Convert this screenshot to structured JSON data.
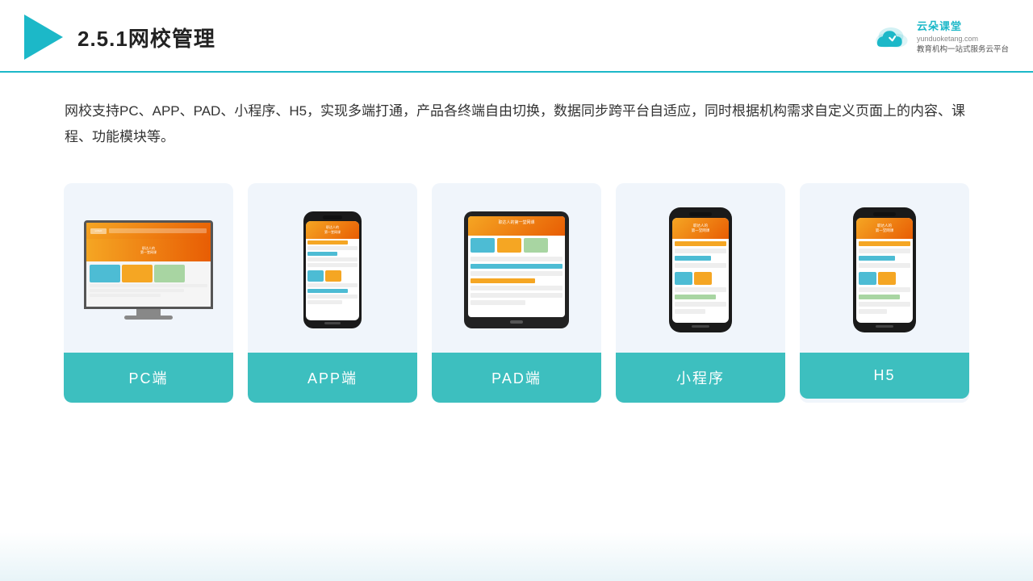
{
  "header": {
    "title": "2.5.1网校管理",
    "brand": {
      "name": "云朵课堂",
      "url": "yunduoketang.com",
      "slogan": "教育机构一站式服务云平台"
    }
  },
  "description": {
    "text": "网校支持PC、APP、PAD、小程序、H5，实现多端打通，产品各终端自由切换，数据同步跨平台自适应，同时根据机构需求自定义页面上的内容、课程、功能模块等。"
  },
  "cards": [
    {
      "id": "pc",
      "label": "PC端"
    },
    {
      "id": "app",
      "label": "APP端"
    },
    {
      "id": "pad",
      "label": "PAD端"
    },
    {
      "id": "miniprogram",
      "label": "小程序"
    },
    {
      "id": "h5",
      "label": "H5"
    }
  ],
  "colors": {
    "accent": "#3dbfbf",
    "header_line": "#1cb8c8"
  }
}
